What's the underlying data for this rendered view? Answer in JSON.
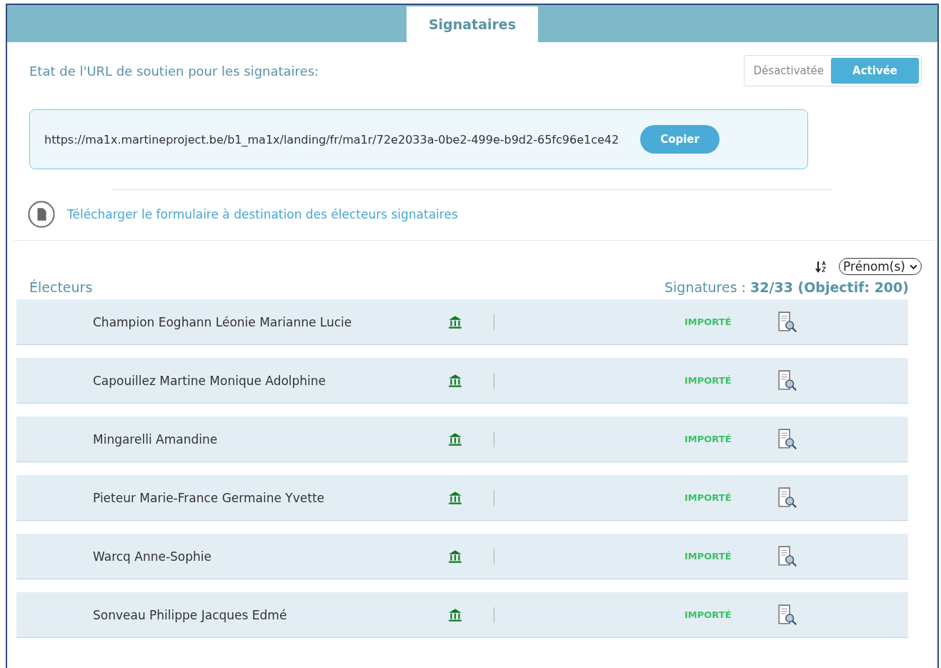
{
  "tabs": [
    {
      "label": "Signataires",
      "selected": true
    }
  ],
  "url_status": {
    "label": "Etat de l'URL de soutien pour les signataires:",
    "options": [
      {
        "label": "Désactivatée",
        "selected": false
      },
      {
        "label": "Activée",
        "selected": true
      }
    ]
  },
  "url_box": {
    "url": "https://ma1x.martineproject.be/b1_ma1x/landing/fr/ma1r/72e2033a-0be2-499e-b9d2-65fc96e1ce42",
    "button": "Copier"
  },
  "download_link": "Télécharger le formulaire à destination des électeurs signataires",
  "sort": {
    "value": "Prénom(s)"
  },
  "voters": {
    "title": "Électeurs",
    "signatures": "Signatures : **32/33 (Objectif: 200)**",
    "rows": [
      {
        "name": "Champion Eoghann Léonie Marianne Lucie",
        "status": "IMPORTÉ"
      },
      {
        "name": "Capouillez Martine Monique Adolphine",
        "status": "IMPORTÉ"
      },
      {
        "name": "Mingarelli Amandine",
        "status": "IMPORTÉ"
      },
      {
        "name": "Pieteur Marie-France Germaine Yvette",
        "status": "IMPORTÉ"
      },
      {
        "name": "Warcq Anne-Sophie",
        "status": "IMPORTÉ"
      },
      {
        "name": "Sonveau Philippe Jacques Edmé",
        "status": "IMPORTÉ"
      }
    ]
  }
}
